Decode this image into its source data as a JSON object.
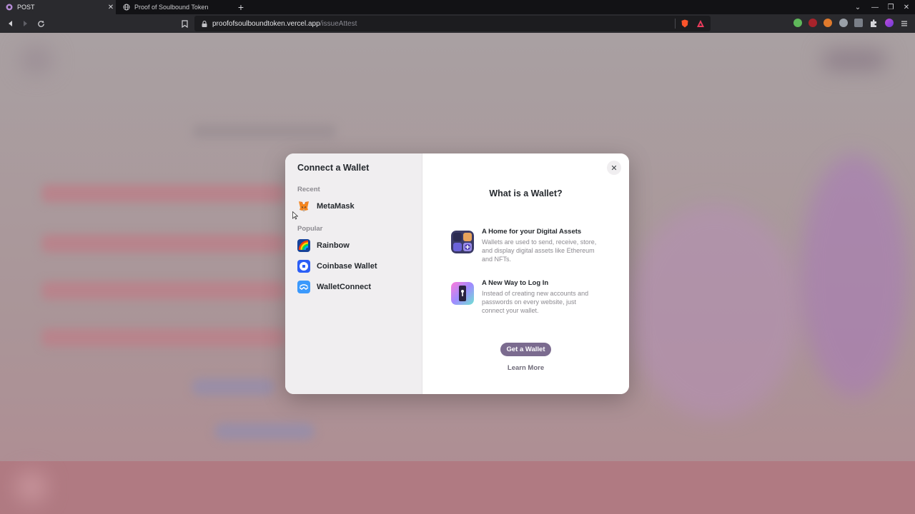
{
  "browser": {
    "tabs": [
      {
        "title": "POST",
        "active": true
      },
      {
        "title": "Proof of Soulbound Token",
        "active": false
      }
    ],
    "url_host": "proofofsoulboundtoken.vercel.app",
    "url_path": "/issueAttest",
    "new_tab_glyph": "+",
    "close_glyph": "✕"
  },
  "modal": {
    "title": "Connect a Wallet",
    "recent_label": "Recent",
    "popular_label": "Popular",
    "recent_wallets": [
      {
        "name": "MetaMask",
        "icon": "metamask-icon"
      }
    ],
    "popular_wallets": [
      {
        "name": "Rainbow",
        "icon": "rainbow-icon"
      },
      {
        "name": "Coinbase Wallet",
        "icon": "coinbase-icon"
      },
      {
        "name": "WalletConnect",
        "icon": "walletconnect-icon"
      }
    ],
    "close_glyph": "✕",
    "info": {
      "title": "What is a Wallet?",
      "features": [
        {
          "heading": "A Home for your Digital Assets",
          "body": "Wallets are used to send, receive, store, and display digital assets like Ethereum and NFTs."
        },
        {
          "heading": "A New Way to Log In",
          "body": "Instead of creating new accounts and passwords on every website, just connect your wallet."
        }
      ],
      "get_wallet_label": "Get a Wallet",
      "learn_more_label": "Learn More"
    }
  },
  "colors": {
    "modal_bg": "#ffffff",
    "sidebar_bg": "#f0eef0",
    "text_primary": "#25292e",
    "text_secondary": "#8c8a90",
    "accent_button": "#7b6b8f",
    "overlay_tint": "#aa9598"
  }
}
